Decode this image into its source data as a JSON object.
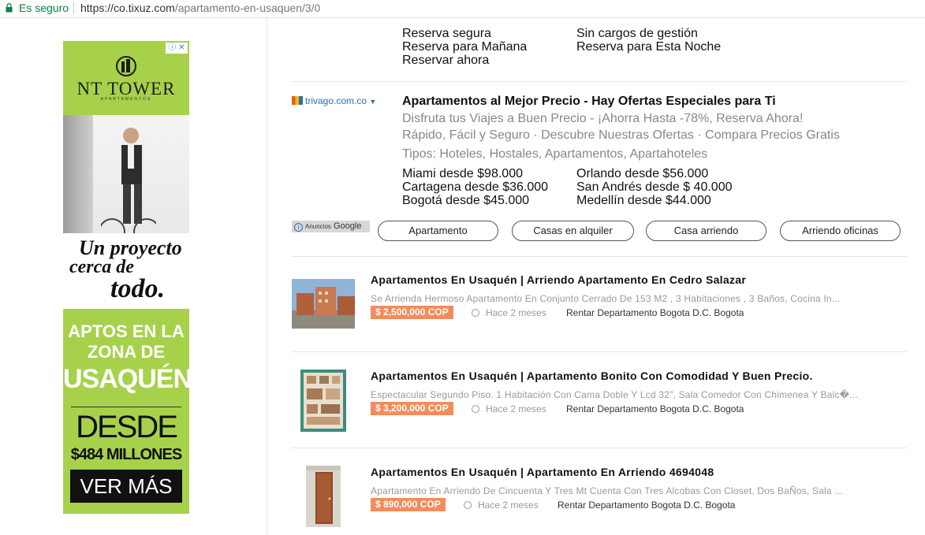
{
  "address_bar": {
    "security_label": "Es seguro",
    "url_host": "https://co.tixuz.com",
    "url_path": "/apartamento-en-usaquen/3/0"
  },
  "ad_banner": {
    "brand": "NT TOWER",
    "brand_sub": "APARTAMENTOS",
    "slogan_line1": "Un proyecto",
    "slogan_line2": "cerca de",
    "slogan_line3": "todo.",
    "headline_line1": "APTOS EN LA",
    "headline_line2": "ZONA DE",
    "headline_line3": "USAQUÉN",
    "desde": "DESDE",
    "price": "$484 MILLONES",
    "cta": "VER MÁS",
    "accent_color": "#a7d14b"
  },
  "sitelinks": {
    "left": [
      "Reserva segura",
      "Reserva para Mañana",
      "Reservar ahora"
    ],
    "right": [
      "Sin cargos de gestión",
      "Reserva para Esta Noche"
    ]
  },
  "text_ad": {
    "display_url": "trivago.com.co",
    "title": "Apartamentos al Mejor Precio - Hay Ofertas Especiales para Ti",
    "desc1": "Disfruta tus Viajes a Buen Precio - ¡Ahorra Hasta -78%, Reserva Ahora!",
    "desc2": "Rápido, Fácil y Seguro · Descubre Nuestras Ofertas · Compara Precios Gratis",
    "desc3": "Tipos: Hoteles, Hostales, Apartamentos, Apartahoteles",
    "cities_left": [
      "Miami desde $98.000",
      "Cartagena desde $36.000",
      "Bogotá desde $45.000"
    ],
    "cities_right": [
      "Orlando desde $56.000",
      "San Andrés desde $ 40.000",
      "Medellín desde $44.000"
    ]
  },
  "google_badge": {
    "small": "Anuncios",
    "brand": "Google"
  },
  "chips": [
    "Apartamento",
    "Casas en alquiler",
    "Casa arriendo",
    "Arriendo oficinas"
  ],
  "listings": [
    {
      "title": "Apartamentos En Usaquén | Arriendo Apartamento En Cedro Salazar",
      "desc": "Se Arrienda Hermoso Apartamento En Conjunto Cerrado De 153 M2 , 3 Habitaciones , 3 Baños, Cocina In...",
      "price": "$ 2,500,000 COP",
      "time": "Hace 2 meses",
      "location": "Rentar Departamento Bogota D.C. Bogota"
    },
    {
      "title": "Apartamentos En Usaquén | Apartamento Bonito Con Comodidad Y Buen Precio.",
      "desc": "Espectacular Segundo Piso. 1 Habitación Con Cama Doble Y Lcd 32\", Sala Comedor Con Chimenea Y Balc�...",
      "price": "$ 3,200,000 COP",
      "time": "Hace 2 meses",
      "location": "Rentar Departamento Bogota D.C. Bogota"
    },
    {
      "title": "Apartamentos En Usaquén | Apartamento En Arriendo 4694048",
      "desc": "Apartamento En Arriendo De Cincuenta Y Tres Mt Cuenta Con Tres Alcobas Con Closet, Dos BaÑos, Sala ...",
      "price": "$ 890,000 COP",
      "time": "Hace 2 meses",
      "location": "Rentar Departamento Bogota D.C. Bogota"
    }
  ]
}
